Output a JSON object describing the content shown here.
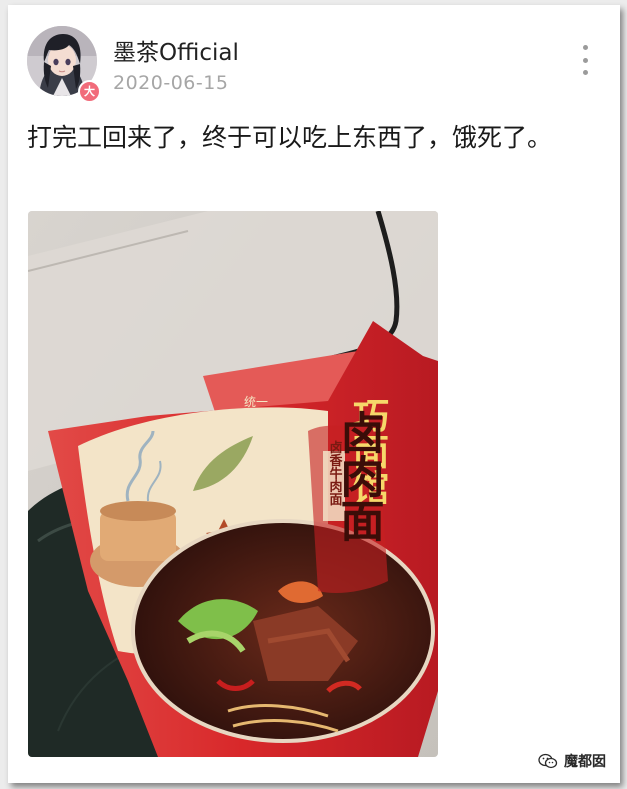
{
  "post": {
    "username": "墨茶Official",
    "date": "2020-06-15",
    "avatar_badge": "大",
    "text": "打完工回来了，终于可以吃上东西了，饿死了。",
    "more_icon": "more-vertical-icon"
  },
  "photo": {
    "package_brand": "统一",
    "package_title": "卤肉面",
    "package_subtitle": "卤香牛肉面",
    "package_side_text": "巧面馆"
  },
  "watermark": {
    "text": "魔都囡",
    "icon": "wechat-icon"
  },
  "colors": {
    "package_red": "#d8282a",
    "date_gray": "#a6a6a6",
    "background": "#ececec"
  }
}
